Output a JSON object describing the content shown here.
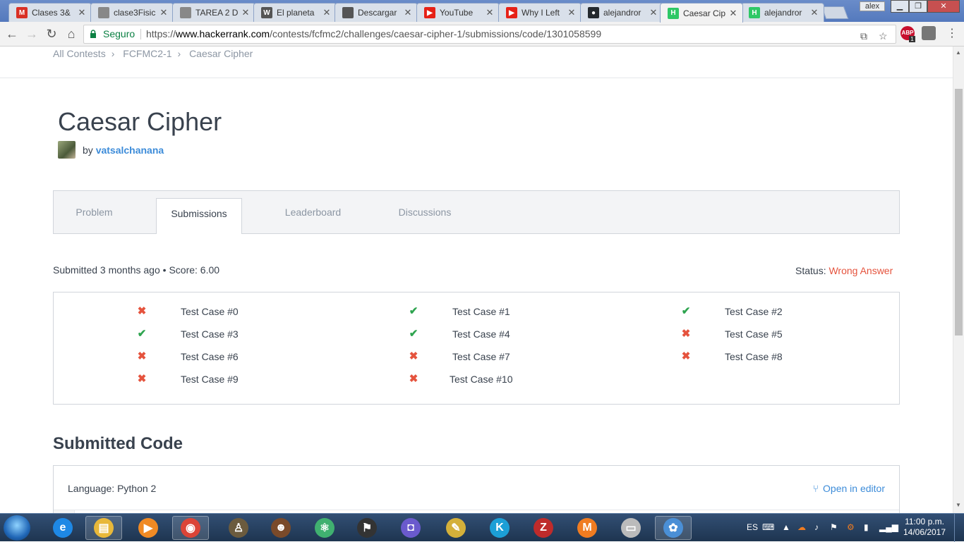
{
  "browser": {
    "tabs": [
      {
        "title": "Clases 3&",
        "icon": "gmail-icon",
        "color": "#d93025",
        "glyph": "M",
        "active": false
      },
      {
        "title": "clase3Fisic",
        "icon": "document-icon",
        "color": "#888888",
        "glyph": "",
        "active": false
      },
      {
        "title": "TAREA 2 D",
        "icon": "document-icon",
        "color": "#888888",
        "glyph": "",
        "active": false
      },
      {
        "title": "El planeta",
        "icon": "wikipedia-icon",
        "color": "#555555",
        "glyph": "W",
        "active": false
      },
      {
        "title": "Descargar",
        "icon": "film-icon",
        "color": "#555555",
        "glyph": "",
        "active": false
      },
      {
        "title": "YouTube",
        "icon": "youtube-icon",
        "color": "#e62117",
        "glyph": "▶",
        "active": false
      },
      {
        "title": "Why I Left",
        "icon": "youtube-icon",
        "color": "#e62117",
        "glyph": "▶",
        "active": false
      },
      {
        "title": "alejandror",
        "icon": "github-icon",
        "color": "#24292e",
        "glyph": "●",
        "active": false
      },
      {
        "title": "Caesar Cip",
        "icon": "hackerrank-icon",
        "color": "#2ec866",
        "glyph": "H",
        "active": true
      },
      {
        "title": "alejandror",
        "icon": "hackerrank-icon",
        "color": "#2ec866",
        "glyph": "H",
        "active": false
      }
    ],
    "window_user": "alex",
    "secure_label": "Seguro",
    "url_scheme": "https://",
    "url_host": "www.hackerrank.com",
    "url_path": "/contests/fcfmc2/challenges/caesar-cipher-1/submissions/code/1301058599",
    "adblock_badge": "1",
    "adblock_text": "ABP"
  },
  "breadcrumb": [
    "All Contests",
    "FCFMC2-1",
    "Caesar Cipher"
  ],
  "challenge": {
    "title": "Caesar Cipher",
    "by": "by",
    "author": "vatsalchanana"
  },
  "nav_tabs": [
    {
      "label": "Problem",
      "active": false
    },
    {
      "label": "Submissions",
      "active": true
    },
    {
      "label": "Leaderboard",
      "active": false
    },
    {
      "label": "Discussions",
      "active": false
    }
  ],
  "submission": {
    "submitted_prefix": "Submitted 3 months ago • Score: ",
    "score": "6.00",
    "status_label": "Status: ",
    "status_value": "Wrong Answer"
  },
  "test_cases": [
    {
      "label": "Test Case #0",
      "passed": false
    },
    {
      "label": "Test Case #1",
      "passed": true
    },
    {
      "label": "Test Case #2",
      "passed": true
    },
    {
      "label": "Test Case #3",
      "passed": true
    },
    {
      "label": "Test Case #4",
      "passed": true
    },
    {
      "label": "Test Case #5",
      "passed": false
    },
    {
      "label": "Test Case #6",
      "passed": false
    },
    {
      "label": "Test Case #7",
      "passed": false
    },
    {
      "label": "Test Case #8",
      "passed": false
    },
    {
      "label": "Test Case #9",
      "passed": false
    },
    {
      "label": "Test Case #10",
      "passed": false
    }
  ],
  "code": {
    "heading": "Submitted Code",
    "language": "Language: Python 2",
    "open_editor": "Open in editor"
  },
  "taskbar": {
    "lang": "ES",
    "time": "11:00 p.m.",
    "date": "14/06/2017",
    "apps": [
      {
        "name": "ie-icon",
        "color": "#1e88e5",
        "glyph": "e",
        "running": false
      },
      {
        "name": "explorer-icon",
        "color": "#e8b83a",
        "glyph": "▤",
        "running": true
      },
      {
        "name": "media-player-icon",
        "color": "#f08a24",
        "glyph": "▶",
        "running": false
      },
      {
        "name": "chrome-icon",
        "color": "#db4437",
        "glyph": "◉",
        "running": true
      },
      {
        "name": "game-character-icon",
        "color": "#6b5b3e",
        "glyph": "♙",
        "running": false
      },
      {
        "name": "game-soldier-icon",
        "color": "#7a4a2a",
        "glyph": "☻",
        "running": false
      },
      {
        "name": "atom-icon",
        "color": "#40b070",
        "glyph": "⚛",
        "running": false
      },
      {
        "name": "flag-icon",
        "color": "#333333",
        "glyph": "⚑",
        "running": false
      },
      {
        "name": "gamepad-icon",
        "color": "#6a5acd",
        "glyph": "◘",
        "running": false
      },
      {
        "name": "chat-bubble-icon",
        "color": "#d4b03a",
        "glyph": "✎",
        "running": false
      },
      {
        "name": "kodi-icon",
        "color": "#1c9fd6",
        "glyph": "K",
        "running": false
      },
      {
        "name": "filezilla-icon",
        "color": "#bf2b2b",
        "glyph": "Z",
        "running": false
      },
      {
        "name": "cloud-icon",
        "color": "#f07c21",
        "glyph": "M",
        "running": false
      },
      {
        "name": "window-icon",
        "color": "#bbbbbb",
        "glyph": "▭",
        "running": false
      },
      {
        "name": "paint-icon",
        "color": "#4a8fd6",
        "glyph": "✿",
        "running": true
      }
    ]
  },
  "colors": {
    "pass": "#2ea44f",
    "fail": "#e5533d",
    "link": "#3d8cd9",
    "text": "#39424e",
    "muted": "#8c96a3"
  }
}
